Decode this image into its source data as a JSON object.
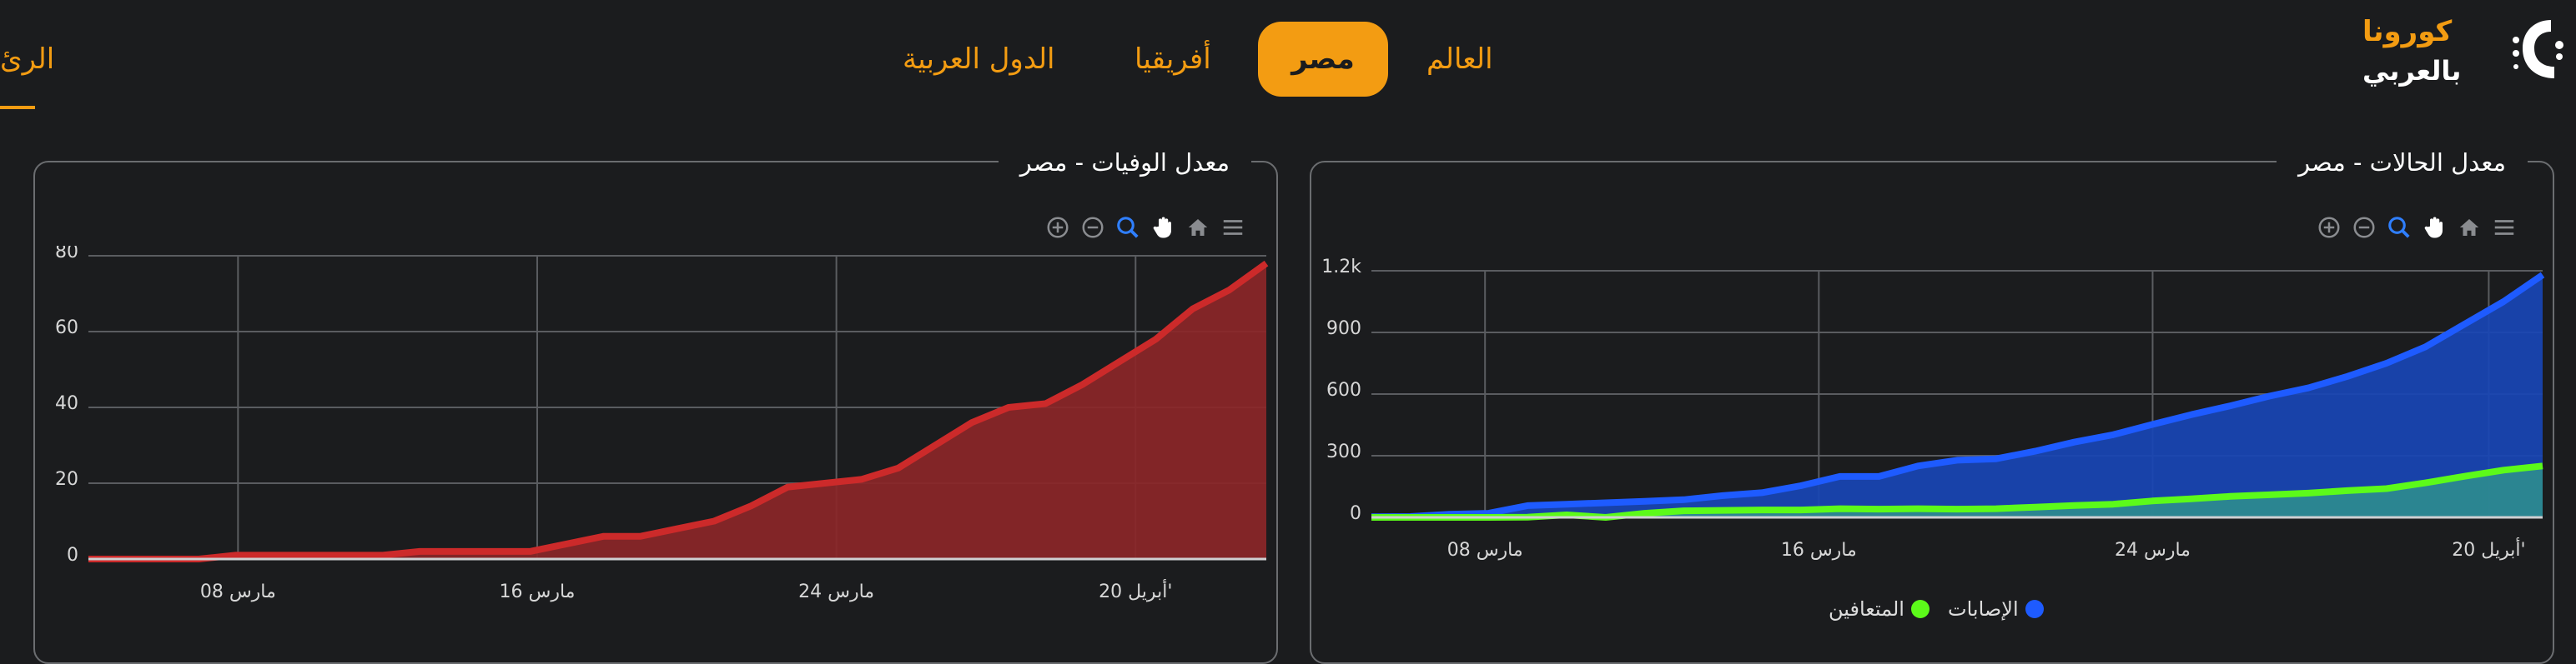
{
  "brand": {
    "title": "كورونا",
    "subtitle": "بالعربي"
  },
  "nav": {
    "items": [
      "العالم",
      "مصر",
      "أفريقيا",
      "الدول العربية"
    ],
    "active": "مصر",
    "home_label": "الرئ"
  },
  "colors": {
    "accent": "#f39c12",
    "infections": "#1e5bff",
    "recovered": "#5cfa1a",
    "deaths": "#cc2a2a",
    "deaths_fill": "#8b2628",
    "infections_fill": "#1845b5",
    "recovered_fill": "#2e8b8f"
  },
  "toolbar_icons": [
    "zoom-in-icon",
    "zoom-out-icon",
    "magnify-icon",
    "pan-hand-icon",
    "home-icon",
    "menu-icon"
  ],
  "cases_card": {
    "title": "معدل الحالات - مصر",
    "legend": [
      {
        "name": "الإصابات",
        "color": "#1e5bff"
      },
      {
        "name": "المتعافين",
        "color": "#5cfa1a"
      }
    ]
  },
  "deaths_card": {
    "title": "معدل الوفيات - مصر"
  },
  "chart_data": [
    {
      "type": "area",
      "title": "معدل الحالات - مصر",
      "x_tick_labels": [
        "مارس 08",
        "مارس 16",
        "مارس 24",
        "أبريل 20'"
      ],
      "y_tick_labels": [
        "0",
        "300",
        "600",
        "900",
        "1.2k"
      ],
      "ylim": [
        0,
        1200
      ],
      "grid": true,
      "legend_position": "bottom",
      "series": [
        {
          "name": "الإصابات",
          "color": "#1e5bff",
          "values": [
            3,
            4,
            15,
            20,
            57,
            64,
            71,
            78,
            86,
            106,
            120,
            154,
            199,
            199,
            250,
            278,
            285,
            322,
            366,
            402,
            452,
            500,
            543,
            590,
            630,
            686,
            750,
            830,
            940,
            1050,
            1180
          ]
        },
        {
          "name": "المتعافين",
          "color": "#5cfa1a",
          "values": [
            0,
            0,
            0,
            0,
            1,
            12,
            0,
            20,
            32,
            34,
            36,
            36,
            42,
            40,
            42,
            40,
            42,
            50,
            58,
            64,
            80,
            90,
            102,
            110,
            118,
            130,
            140,
            168,
            200,
            230,
            250
          ]
        }
      ]
    },
    {
      "type": "area",
      "title": "معدل الوفيات - مصر",
      "x_tick_labels": [
        "مارس 08",
        "مارس 16",
        "مارس 24",
        "أبريل 20'"
      ],
      "y_tick_labels": [
        "0",
        "20",
        "40",
        "60",
        "80"
      ],
      "ylim": [
        0,
        80
      ],
      "grid": true,
      "series": [
        {
          "name": "الوفيات",
          "color": "#cc2a2a",
          "values": [
            0,
            0,
            0,
            0,
            1,
            1,
            1,
            1,
            1,
            2,
            2,
            2,
            2,
            4,
            6,
            6,
            8,
            10,
            14,
            19,
            20,
            21,
            24,
            30,
            36,
            40,
            41,
            46,
            52,
            58,
            66,
            71,
            78
          ]
        }
      ]
    }
  ]
}
